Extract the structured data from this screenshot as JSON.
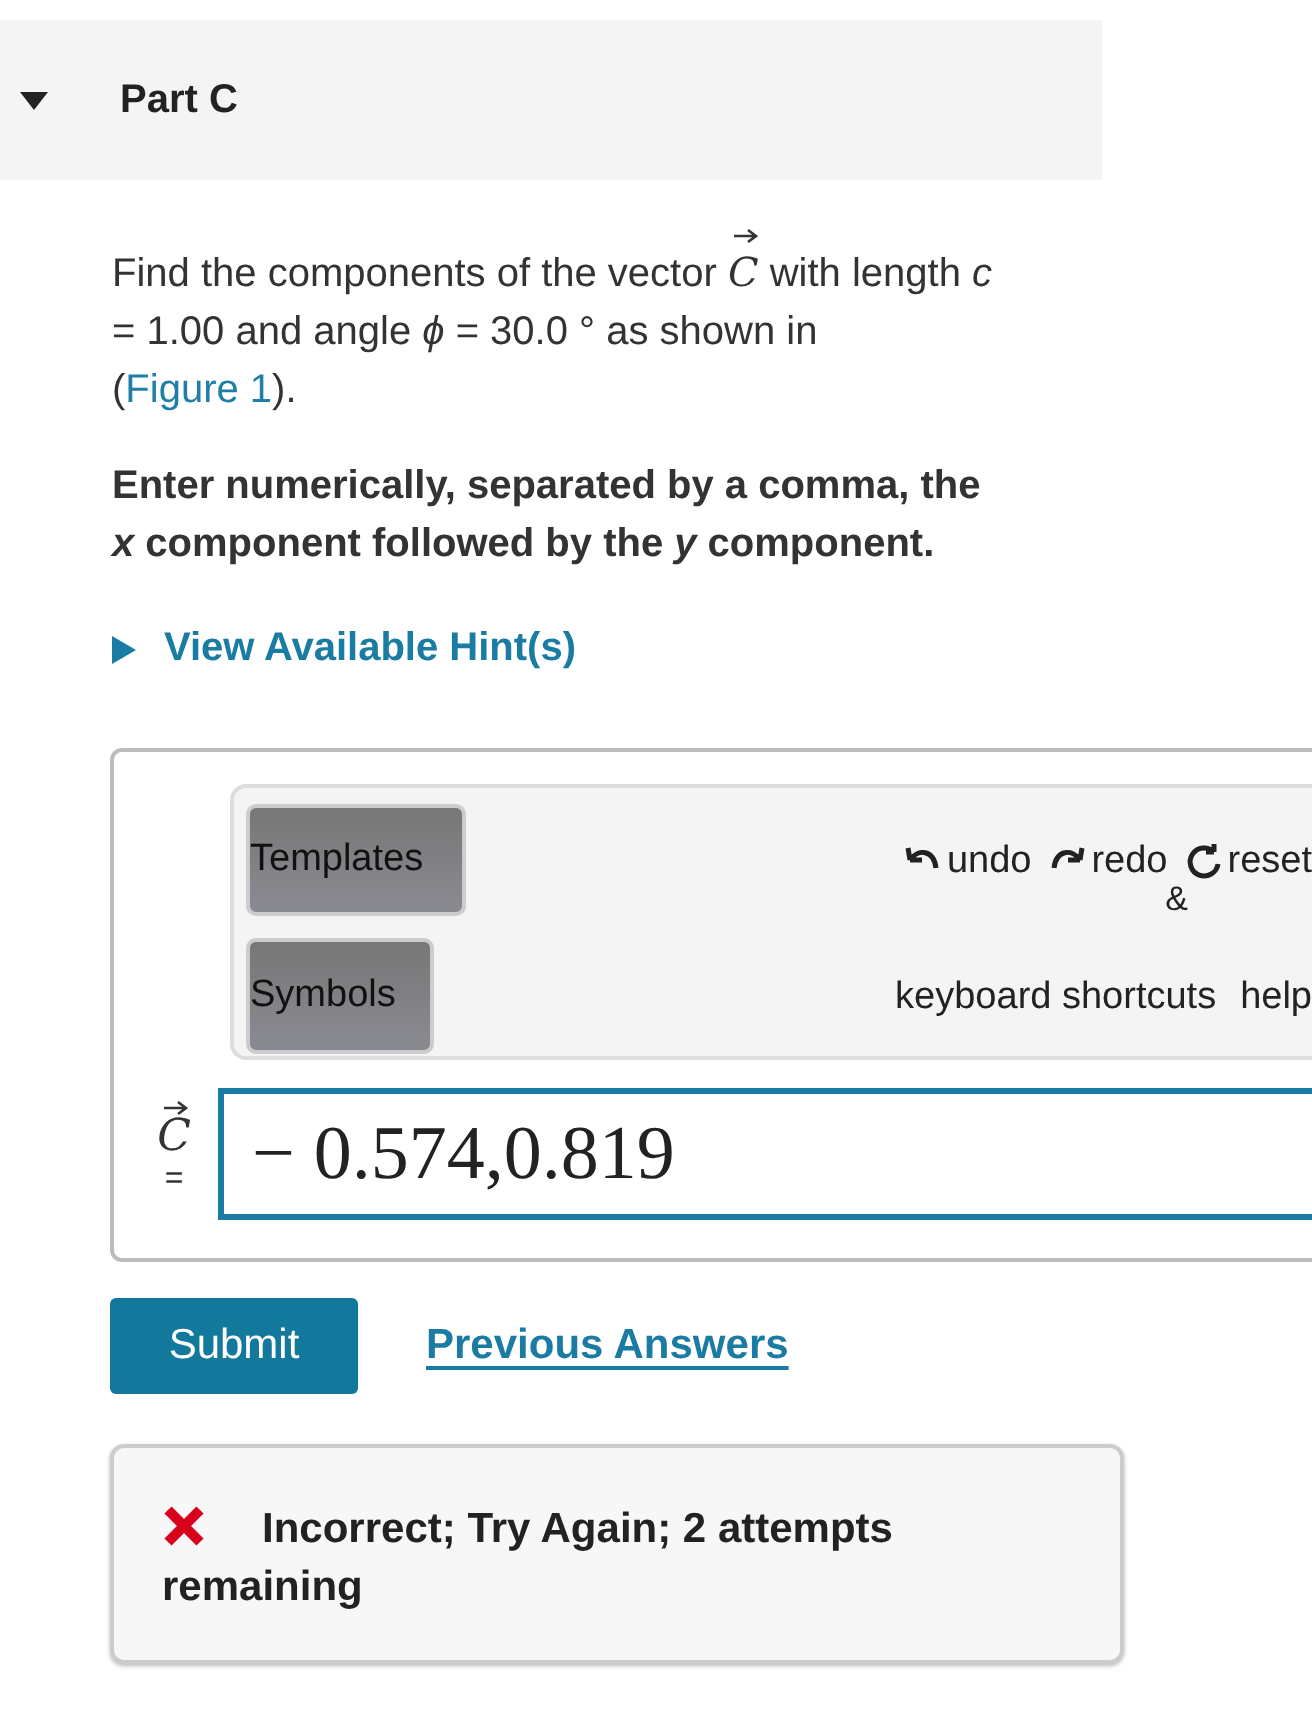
{
  "part": {
    "title": "Part C",
    "expanded": true
  },
  "prompt": {
    "before": "Find the components of the vector ",
    "vector": "C",
    "middle": " with length *c* = 1.00 and angle *ϕ* = 30.0 ° as shown in (",
    "link": "Figure 1",
    "after": ")."
  },
  "instruction": "Enter numerically, separated by a comma, the *x* component followed by the *y* component.",
  "hints": {
    "label": "View Available Hint(s)",
    "expanded": false
  },
  "toolbar": {
    "buttons": [
      "Templates",
      "Symbols"
    ],
    "actions": [
      "undo",
      "redo",
      "reset"
    ],
    "stray": "&",
    "links": [
      "keyboard shortcuts",
      "help"
    ]
  },
  "answer": {
    "label": "C",
    "equals": "=",
    "value": "− 0.574,0.819"
  },
  "buttons": {
    "submit": "Submit",
    "previous": "Previous Answers"
  },
  "feedback": {
    "correct": false,
    "text": "Incorrect; Try Again; 2 attempts remaining"
  }
}
